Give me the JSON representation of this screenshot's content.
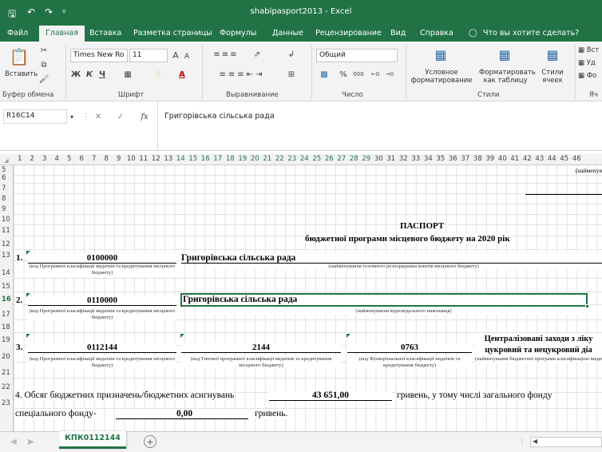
{
  "titlebar": {
    "title": "shablpasport2013  -  Excel"
  },
  "menu": {
    "file": "Файл",
    "home": "Главная",
    "insert": "Вставка",
    "layout": "Разметка страницы",
    "formulas": "Формулы",
    "data": "Данные",
    "review": "Рецензирование",
    "view": "Вид",
    "help": "Справка",
    "tell_me": "Что вы хотите сделать?"
  },
  "ribbon": {
    "paste": "Вставить",
    "clipboard": "Буфер обмена",
    "font_name": "Times New Ro",
    "font_size": "11",
    "bold": "Ж",
    "italic": "К",
    "underline": "Ч",
    "font_group": "Шрифт",
    "align_group": "Выравнивание",
    "number_format": "Общий",
    "percent": "%",
    "thousands": "000",
    "number_group": "Число",
    "cond_format": "Условное форматирование",
    "format_table": "Форматировать как таблицу",
    "cell_styles": "Стили ячеек",
    "styles_group": "Стили",
    "insert_cells": "Вст",
    "delete_cells": "Уд",
    "format_cells": "Фо",
    "cells_group": "Яч"
  },
  "formula_bar": {
    "name_box": "R16C14",
    "fx": "fx",
    "content": "Григорівська сільська рада"
  },
  "columns": [
    "1",
    "2",
    "3",
    "4",
    "5",
    "6",
    "7",
    "8",
    "9",
    "10",
    "11",
    "12",
    "13",
    "14",
    "15",
    "16",
    "17",
    "18",
    "19",
    "20",
    "21",
    "22",
    "23",
    "24",
    "25",
    "26",
    "27",
    "28",
    "29",
    "30",
    "31",
    "32",
    "33",
    "34",
    "35",
    "36",
    "37",
    "38",
    "39",
    "40",
    "41",
    "42",
    "43",
    "44",
    "45",
    "46"
  ],
  "rows": [
    "5",
    "6",
    "7",
    "8",
    "9",
    "10",
    "11",
    "12",
    "13",
    "14",
    "15",
    "16",
    "17",
    "18",
    "19",
    "20",
    "21",
    "22",
    "23"
  ],
  "doc": {
    "top_right": "(найменув",
    "title": "ПАСПОРТ",
    "subtitle": "бюджетної програми місцевого бюджету на 2020  рік",
    "r13_num": "1.",
    "r13_code": "0100000",
    "r13_name": "Григорівська сільська рада",
    "r14_note_left": "(код Програмної класифікації видатків та кредитування місцевого бюджету)",
    "r14_note_right": "(найменування головного розпорядника коштів місцевого бюджету)",
    "r16_num": "2.",
    "r16_code": "0110000",
    "r16_name": "Григорівська сільська рада",
    "r17_note_left": "(код Програмної класифікації видатків та кредитування місцевого бюджету)",
    "r17_note_right": "(найменування відповідального виконавця)",
    "r19_num": "3.",
    "r19_code": "0112144",
    "r19_code2": "2144",
    "r19_code3": "0763",
    "r19_name": "Централізовані заходи з ліку цукровий та нецукровий діа",
    "r20_note1": "(код Програмної класифікації видатків та кредитування місцевого бюджету)",
    "r20_note2": "(код Типової програмної класифікації видатків та кредитування місцевого бюджету)",
    "r20_note3": "(код Функціональної класифікації видатків та кредитування бюджету)",
    "r20_note4": "(найменування бюджетної програми класифікацією видатків та креди",
    "r22_text": "4. Обсяг бюджетних призначень/бюджетних асигнувань",
    "r22_amount": "43 651,00",
    "r22_tail": "гривень, у тому числі загального фонду",
    "r23_text": "спеціального фонду-",
    "r23_amount": "0,00",
    "r23_tail": "гривень."
  },
  "tabs": {
    "sheet": "КПК0112144"
  }
}
